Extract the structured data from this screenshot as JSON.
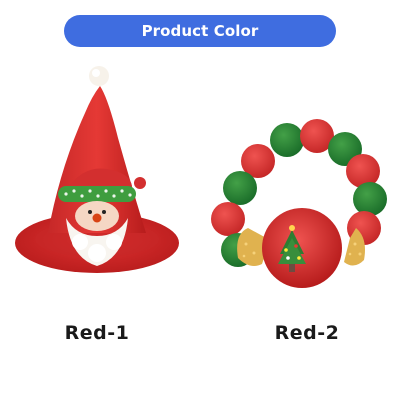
{
  "header": {
    "title": "Product Color",
    "accent_color": "#3f6de0"
  },
  "products": [
    {
      "label": "Red-1",
      "image": "santa-hat-with-snowman"
    },
    {
      "label": "Red-2",
      "image": "red-green-pompom-collar-with-christmas-tree-candy"
    }
  ]
}
